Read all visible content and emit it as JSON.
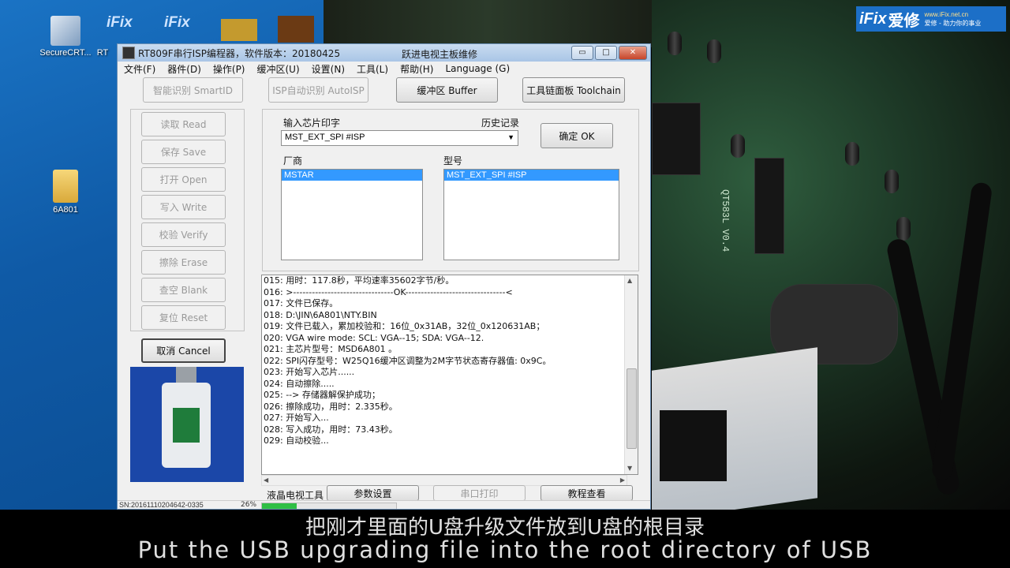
{
  "desktop": {
    "icons": [
      {
        "label": "SecureCRT..."
      },
      {
        "label": "RT"
      },
      {
        "label": "6A801"
      }
    ],
    "ifix_icon_text": "iFix"
  },
  "logo": {
    "brand": "iFix",
    "brand_cn": "爱修",
    "url": "www.iFix.net.cn",
    "slogan": "爱修 - 助力你的事业"
  },
  "window": {
    "title": "RT809F串行ISP编程器，软件版本：20180425",
    "company": "跃进电视主板维修",
    "minimize": "▭",
    "maximize": "□",
    "close": "✕"
  },
  "menu": [
    "文件(F)",
    "器件(D)",
    "操作(P)",
    "缓冲区(U)",
    "设置(N)",
    "工具(L)",
    "帮助(H)",
    "Language (G)"
  ],
  "top_buttons": {
    "smart_id": "智能识别 SmartID",
    "auto_isp": "ISP自动识别 AutoISP",
    "buffer": "缓冲区 Buffer",
    "toolchain": "工具链面板 Toolchain"
  },
  "side_buttons": {
    "read": "读取 Read",
    "save": "保存 Save",
    "open": "打开 Open",
    "write": "写入 Write",
    "verify": "校验 Verify",
    "erase": "擦除 Erase",
    "blank": "查空 Blank",
    "reset": "复位 Reset",
    "cancel": "取消 Cancel"
  },
  "chip_panel": {
    "input_label": "输入芯片印字",
    "history_label": "历史记录",
    "chip_value": "MST_EXT_SPI #ISP",
    "ok_button": "确定 OK",
    "vendor_label": "厂商",
    "model_label": "型号",
    "vendor_selected": "MSTAR",
    "model_selected": "MST_EXT_SPI #ISP"
  },
  "log_lines": [
    "015: 用时：117.8秒，平均速率35602字节/秒。",
    "016: >--------------------------------OK--------------------------------<",
    "017: 文件已保存。",
    "018: D:\\JIN\\6A801\\NTY.BIN",
    "019: 文件已载入，累加校验和：16位_0x31AB，32位_0x120631AB；",
    "020: VGA wire mode: SCL: VGA--15; SDA: VGA--12.",
    "021: 主芯片型号：MSD6A801 。",
    "022: SPI闪存型号：W25Q16缓冲区调整为2M字节状态寄存器值: 0x9C。",
    "023: 开始写入芯片......",
    "024: 自动擦除.....",
    "025: --> 存储器解保护成功；",
    "026: 擦除成功，用时：2.335秒。",
    "027: 开始写入...",
    "028: 写入成功，用时：73.43秒。",
    "029: 自动校验..."
  ],
  "bottom_bar": {
    "lcd_tools": "液晶电视工具",
    "params": "参数设置",
    "serial_print": "串口打印",
    "tutorial": "教程查看"
  },
  "status": {
    "sn": "SN:20161110204642-0335",
    "percent": "26%",
    "progress_fraction": 0.26
  },
  "subtitle": {
    "cn": "把刚才里面的U盘升级文件放到U盘的根目录",
    "en": "Put the USB upgrading file into the root directory of USB"
  },
  "video": {
    "pcb_label": "QT583L V0.4"
  },
  "colors": {
    "selection": "#3399ff",
    "progress": "#2fbf45",
    "logo_bg": "#1c6fc7"
  }
}
